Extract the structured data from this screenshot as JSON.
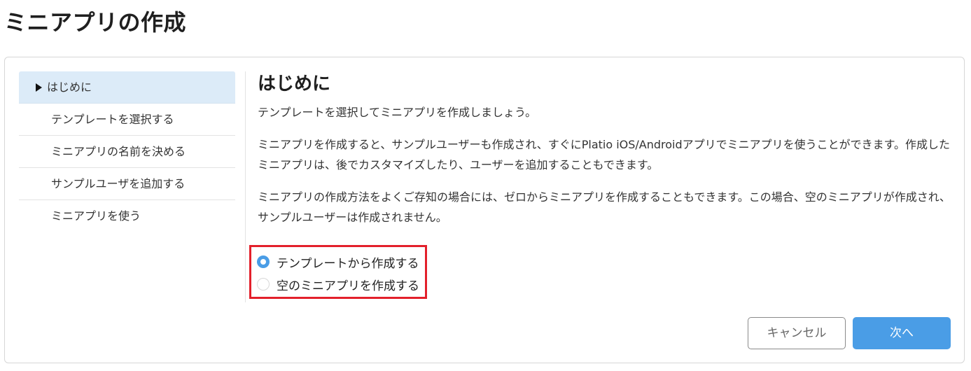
{
  "page": {
    "title": "ミニアプリの作成"
  },
  "steps": [
    {
      "label": "はじめに",
      "active": true
    },
    {
      "label": "テンプレートを選択する",
      "active": false
    },
    {
      "label": "ミニアプリの名前を決める",
      "active": false
    },
    {
      "label": "サンプルユーザを追加する",
      "active": false
    },
    {
      "label": "ミニアプリを使う",
      "active": false
    }
  ],
  "content": {
    "heading": "はじめに",
    "paragraph1": "テンプレートを選択してミニアプリを作成しましょう。",
    "paragraph2": "ミニアプリを作成すると、サンプルユーザーも作成され、すぐにPlatio iOS/Androidアプリでミニアプリを使うことができます。作成したミニアプリは、後でカスタマイズしたり、ユーザーを追加することもできます。",
    "paragraph3": "ミニアプリの作成方法をよくご存知の場合には、ゼロからミニアプリを作成することもできます。この場合、空のミニアプリが作成され、サンプルユーザーは作成されません。"
  },
  "options": [
    {
      "label": "テンプレートから作成する",
      "selected": true
    },
    {
      "label": "空のミニアプリを作成する",
      "selected": false
    }
  ],
  "buttons": {
    "cancel_label": "キャンセル",
    "next_label": "次へ"
  },
  "colors": {
    "accent": "#4a9de6",
    "active_step_bg": "#dcebf8",
    "highlight_border": "#e3202b"
  }
}
